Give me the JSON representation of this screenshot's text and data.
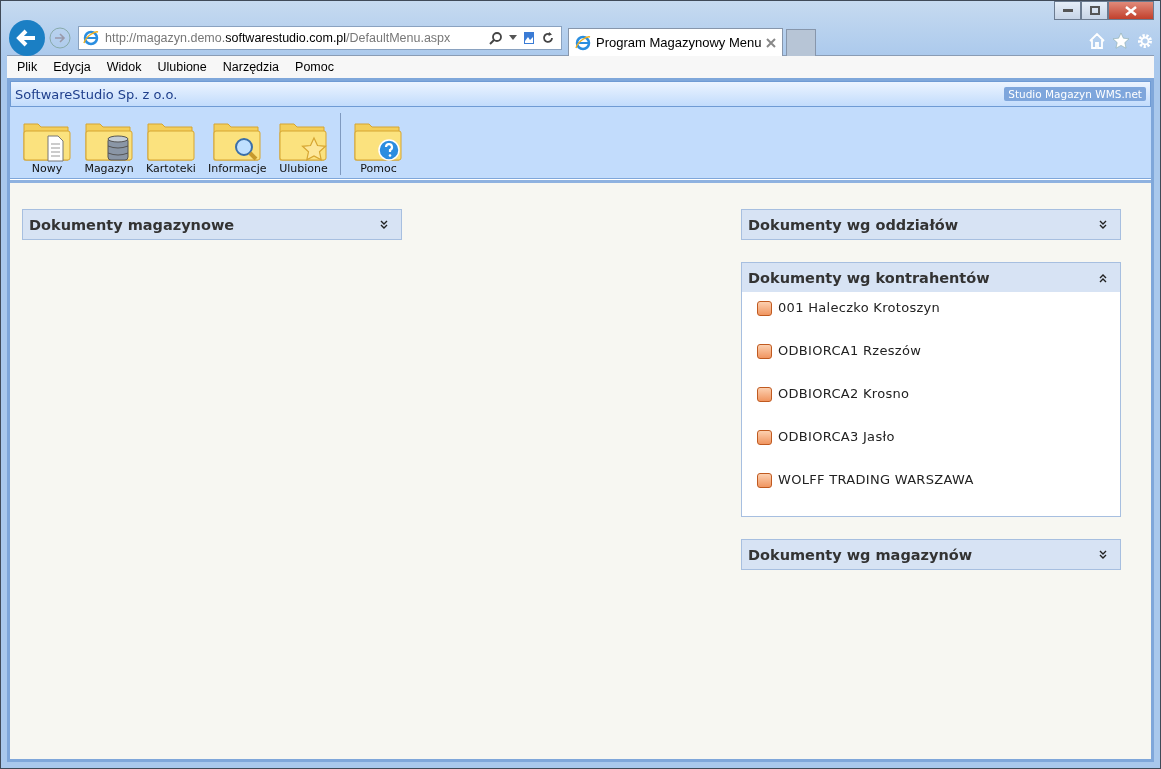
{
  "browser": {
    "address": {
      "host_before": "http://magazyn.demo.",
      "host_main": "softwarestudio.com.pl",
      "path": "/DefaultMenu.aspx"
    },
    "tabs": [
      {
        "title": "Program Magazynowy Menu",
        "selected": true
      }
    ],
    "menu": [
      "Plik",
      "Edycja",
      "Widok",
      "Ulubione",
      "Narzędzia",
      "Pomoc"
    ]
  },
  "header": {
    "company": "SoftwareStudio Sp. z o.o.",
    "product": "Studio Magazyn WMS.net"
  },
  "toolbar": [
    {
      "label": "Nowy",
      "kind": "document",
      "separator_before": false
    },
    {
      "label": "Magazyn",
      "kind": "database",
      "separator_before": false
    },
    {
      "label": "Kartoteki",
      "kind": "plain",
      "separator_before": false
    },
    {
      "label": "Informacje",
      "kind": "search",
      "separator_before": false
    },
    {
      "label": "Ulubione",
      "kind": "star",
      "separator_before": false
    },
    {
      "label": "Pomoc",
      "kind": "help",
      "separator_before": true
    }
  ],
  "columns": [
    {
      "panels": [
        {
          "title": "Dokumenty magazynowe",
          "expanded": false
        }
      ]
    },
    {
      "panels": [
        {
          "title": "Dokumenty wg oddziałów",
          "expanded": false
        },
        {
          "title": "Dokumenty wg kontrahentów",
          "expanded": true,
          "items": [
            "001 Haleczko Krotoszyn",
            "ODBIORCA1 Rzeszów",
            "ODBIORCA2 Krosno",
            "ODBIORCA3 Jasło",
            "WOLFF TRADING WARSZAWA"
          ]
        },
        {
          "title": "Dokumenty wg magazynów",
          "expanded": false
        }
      ]
    }
  ]
}
